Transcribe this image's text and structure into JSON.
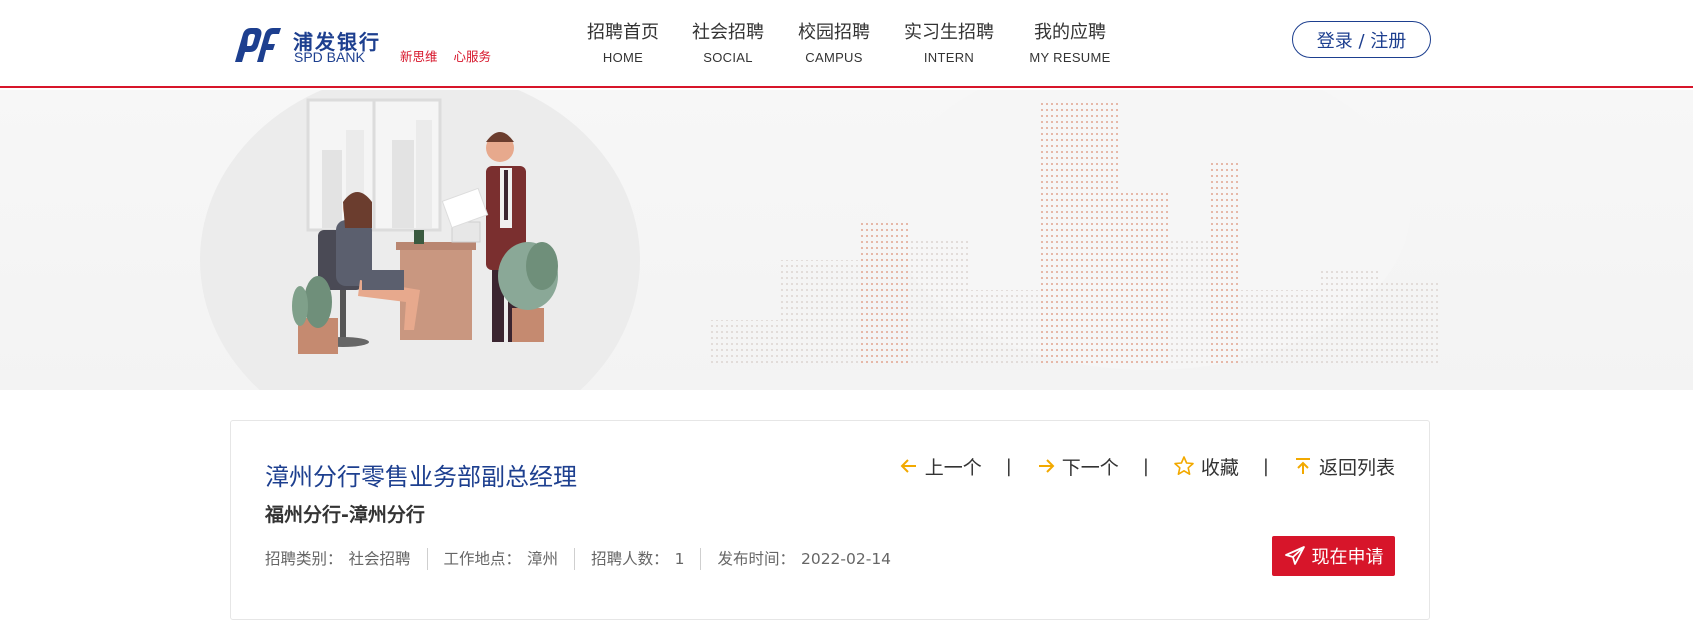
{
  "brand": {
    "name_cn": "浦发银行",
    "name_en": "SPD BANK",
    "slogan": [
      "新思维",
      "心服务"
    ],
    "primary_color": "#1d3f8f",
    "accent_color": "#d7152a"
  },
  "nav": {
    "items": [
      {
        "cn": "招聘首页",
        "en": "HOME"
      },
      {
        "cn": "社会招聘",
        "en": "SOCIAL"
      },
      {
        "cn": "校园招聘",
        "en": "CAMPUS"
      },
      {
        "cn": "实习生招聘",
        "en": "INTERN"
      },
      {
        "cn": "我的应聘",
        "en": "MY RESUME"
      }
    ],
    "login_label": "登录 / 注册"
  },
  "job": {
    "title": "漳州分行零售业务部副总经理",
    "department": "福州分行-漳州分行",
    "meta": [
      {
        "label": "招聘类别：",
        "value": "社会招聘"
      },
      {
        "label": "工作地点：",
        "value": "漳州"
      },
      {
        "label": "招聘人数：",
        "value": "1"
      },
      {
        "label": "发布时间：",
        "value": "2022-02-14"
      }
    ],
    "actions": {
      "prev": "上一个",
      "next": "下一个",
      "favorite": "收藏",
      "back": "返回列表",
      "separator": "|"
    },
    "apply_label": "现在申请"
  },
  "icons": {
    "prev": "arrow-left-icon",
    "next": "arrow-right-icon",
    "favorite": "star-outline-icon",
    "back": "arrow-up-to-top-icon",
    "apply": "paper-plane-icon",
    "action_icon_color": "#f2a900"
  }
}
